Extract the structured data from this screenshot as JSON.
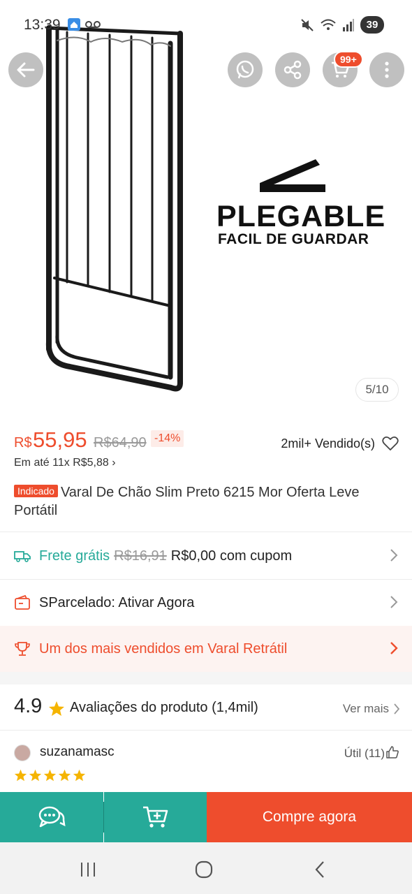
{
  "status_bar": {
    "time": "13:39",
    "battery": "39"
  },
  "header": {
    "cart_badge": "99+"
  },
  "image": {
    "headline": "PLEGABLE",
    "subheadline": "FACIL DE GUARDAR",
    "counter": "5/10"
  },
  "price": {
    "currency": "R$",
    "current": "55,95",
    "original": "R$64,90",
    "discount": "-14%",
    "sold": "2mil+ Vendido(s)",
    "installments": "Em até 11x R$5,88 ›"
  },
  "product": {
    "badge": "Indicado",
    "title": "Varal De Chão Slim Preto 6215 Mor Oferta Leve Portátil"
  },
  "shipping": {
    "label": "Frete grátis",
    "old_price": "R$16,91",
    "new_price": "R$0,00 com cupom"
  },
  "sparcelado": {
    "text": "SParcelado: Ativar Agora"
  },
  "bestseller": {
    "text": "Um dos mais vendidos em Varal Retrátil"
  },
  "ratings": {
    "score": "4.9",
    "label": "Avaliações do produto",
    "count": "(1,4mil)",
    "see_more": "Ver mais"
  },
  "review": {
    "user": "suzanamasc",
    "helpful": "Útil (11)",
    "stars": 5
  },
  "actions": {
    "buy_now": "Compre agora"
  },
  "colors": {
    "brand": "#ee4d2d",
    "teal": "#26aa99"
  }
}
